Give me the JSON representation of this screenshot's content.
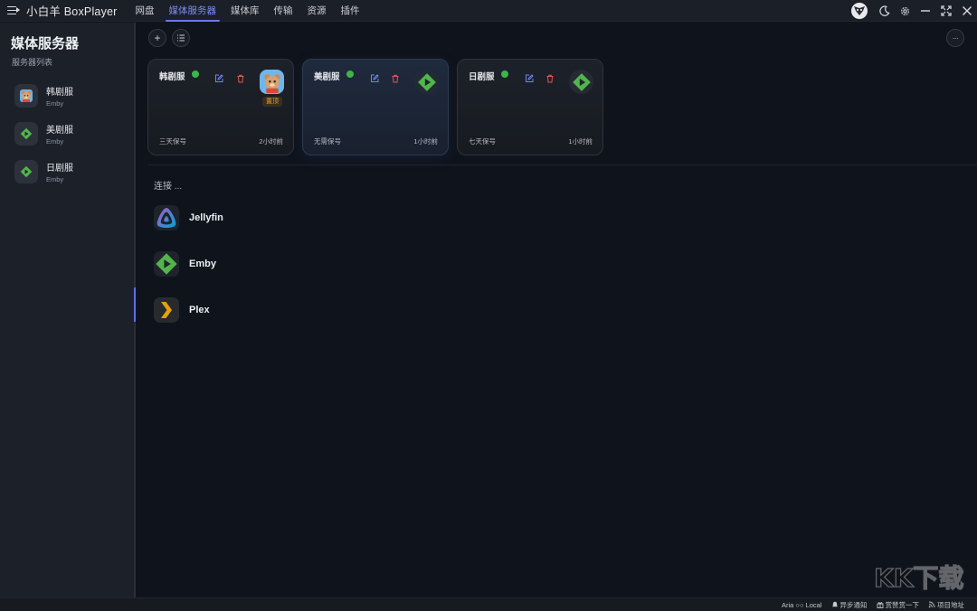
{
  "app": {
    "title": "小白羊 BoxPlayer"
  },
  "nav": {
    "tabs": [
      "网盘",
      "媒体服务器",
      "媒体库",
      "传输",
      "资源",
      "插件"
    ],
    "active": "媒体服务器"
  },
  "sidebar": {
    "title": "媒体服务器",
    "subtitle": "服务器列表",
    "items": [
      {
        "name": "韩剧服",
        "type": "Emby",
        "icon": "bear-icon"
      },
      {
        "name": "美剧服",
        "type": "Emby",
        "icon": "emby-icon"
      },
      {
        "name": "日剧服",
        "type": "Emby",
        "icon": "emby-icon"
      }
    ]
  },
  "toolbar": {
    "add_label": "+",
    "more_label": "···"
  },
  "cards": [
    {
      "name": "韩剧服",
      "status": "online",
      "badge": "置顶",
      "footer_left": "三天保号",
      "footer_right": "2小时前",
      "logo": "bear-icon"
    },
    {
      "name": "美剧服",
      "status": "online",
      "footer_left": "无需保号",
      "footer_right": "1小时前",
      "logo": "emby-icon"
    },
    {
      "name": "日剧服",
      "status": "online",
      "footer_left": "七天保号",
      "footer_right": "1小时前",
      "logo": "emby-icon"
    }
  ],
  "connect": {
    "label": "连接 ...",
    "providers": [
      {
        "name": "Jellyfin",
        "icon": "jellyfin-icon"
      },
      {
        "name": "Emby",
        "icon": "emby-icon"
      },
      {
        "name": "Plex",
        "icon": "plex-icon"
      }
    ]
  },
  "statusbar": {
    "aria": "Aria ○○ Local",
    "async_notify": "异步通知",
    "praise": "赏赞赏一下",
    "project": "项目地址"
  },
  "watermark": {
    "text": "KK下载"
  },
  "colors": {
    "accent": "#6b79f0",
    "online": "#3cb64a",
    "emby_green": "#52b54b",
    "plex_yellow": "#e5a00d",
    "pin": "#e3a43c"
  }
}
